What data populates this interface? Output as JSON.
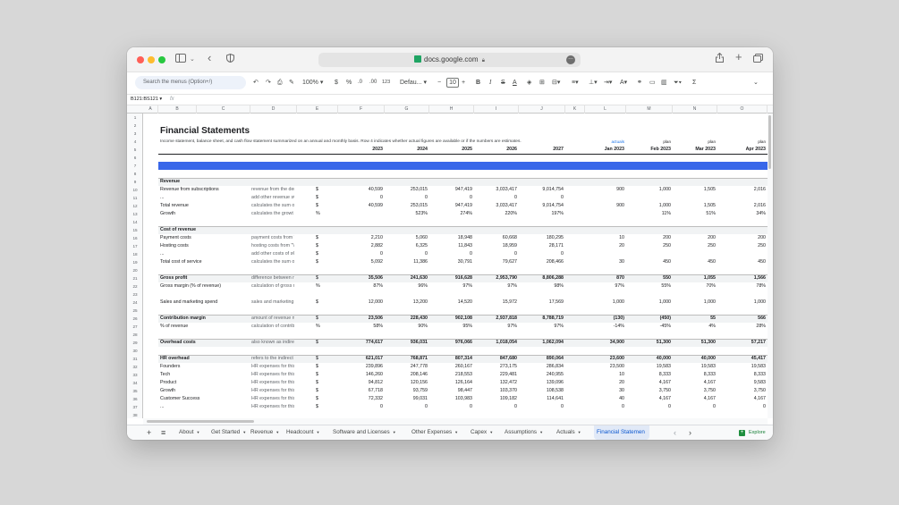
{
  "browser": {
    "url": "docs.google.com"
  },
  "toolbar": {
    "search_placeholder": "Search the menus (Option+/)",
    "zoom": "100%",
    "currency": "$",
    "percent": "%",
    "dec_less": ".0",
    "dec_more": ".00",
    "format_123": "123",
    "font": "Defau...",
    "font_size": "10",
    "bold": "B",
    "italic": "I"
  },
  "formula": {
    "name_box": "B121:BS121",
    "fx": "fx"
  },
  "columns": [
    "A",
    "B",
    "C",
    "D",
    "E",
    "F",
    "G",
    "H",
    "I",
    "J",
    "K",
    "L",
    "M",
    "N",
    "O"
  ],
  "row_numbers": [
    "1",
    "2",
    "3",
    "4",
    "5",
    "6",
    "7",
    "8",
    "9",
    "10",
    "11",
    "12",
    "13",
    "14",
    "15",
    "16",
    "17",
    "18",
    "19",
    "20",
    "21",
    "22",
    "23",
    "24",
    "25",
    "26",
    "27",
    "28",
    "29",
    "30",
    "31",
    "32",
    "33",
    "34",
    "35",
    "36",
    "37",
    "38"
  ],
  "sheet": {
    "title": "Financial Statements",
    "subtitle": "Income statement, balance sheet, and cash flow statement summarized on an annual and monthly basis. Row 4 indicates whether actual figures are available or if the numbers are estimates.",
    "status_row": [
      "actuals",
      "plan",
      "plan",
      "plan"
    ],
    "header_row": [
      "2023",
      "2024",
      "2025",
      "2026",
      "2027",
      "Jan 2023",
      "Feb 2023",
      "Mar 2023",
      "Apr 2023"
    ],
    "section": "Income Statement (P&L)",
    "rows": [
      {
        "r": 9,
        "label": "Revenue",
        "bold": true,
        "top": true
      },
      {
        "r": 10,
        "label": "Revenue from subscriptions",
        "desc": "revenue from the der",
        "unit": "$",
        "v": [
          "40,599",
          "253,015",
          "947,419",
          "3,033,417",
          "9,014,754",
          "",
          "900",
          "1,000",
          "1,505",
          "2,016"
        ]
      },
      {
        "r": 11,
        "label": "...",
        "desc": "add other revenue s€",
        "unit": "$",
        "v": [
          "0",
          "0",
          "0",
          "0",
          "0",
          "",
          "",
          "",
          "",
          ""
        ]
      },
      {
        "r": 12,
        "label": "Total revenue",
        "desc": "calculates the sum o",
        "unit": "$",
        "v": [
          "40,599",
          "253,015",
          "947,419",
          "3,033,417",
          "9,014,754",
          "",
          "900",
          "1,000",
          "1,505",
          "2,016"
        ]
      },
      {
        "r": 13,
        "label": "Growth",
        "desc": "calculates the growt",
        "unit": "%",
        "v": [
          "",
          "523%",
          "274%",
          "220%",
          "197%",
          "",
          "",
          "11%",
          "51%",
          "34%"
        ]
      },
      {
        "r": 15,
        "label": "Cost of revenue",
        "bold": true,
        "top": true
      },
      {
        "r": 16,
        "label": "Payment costs",
        "desc": "payment costs from '",
        "unit": "$",
        "v": [
          "2,210",
          "5,060",
          "18,948",
          "60,668",
          "180,295",
          "",
          "10",
          "200",
          "200",
          "200"
        ]
      },
      {
        "r": 17,
        "label": "Hosting costs",
        "desc": "hosting costs from \"\\",
        "unit": "$",
        "v": [
          "2,882",
          "6,325",
          "11,843",
          "18,959",
          "28,171",
          "",
          "20",
          "250",
          "250",
          "250"
        ]
      },
      {
        "r": 18,
        "label": "...",
        "desc": "add other costs of s€",
        "unit": "$",
        "v": [
          "0",
          "0",
          "0",
          "0",
          "0",
          "",
          "",
          "",
          "",
          ""
        ]
      },
      {
        "r": 19,
        "label": "Total cost of service",
        "desc": "calculates the sum o",
        "unit": "$",
        "v": [
          "5,092",
          "11,386",
          "30,791",
          "79,627",
          "208,466",
          "",
          "30",
          "450",
          "450",
          "450"
        ]
      },
      {
        "r": 21,
        "label": "Gross profit",
        "bold": true,
        "top": true,
        "desc": "difference between r",
        "unit": "$",
        "v": [
          "35,506",
          "241,630",
          "916,628",
          "2,953,790",
          "8,806,288",
          "",
          "870",
          "550",
          "1,055",
          "1,566"
        ]
      },
      {
        "r": 22,
        "label": "Gross margin (% of revenue)",
        "desc": "calculation of gross r",
        "unit": "%",
        "v": [
          "87%",
          "96%",
          "97%",
          "97%",
          "98%",
          "",
          "97%",
          "55%",
          "70%",
          "78%"
        ]
      },
      {
        "r": 24,
        "label": "Sales and marketing spend",
        "desc": "sales and marketing",
        "unit": "$",
        "v": [
          "12,000",
          "13,200",
          "14,520",
          "15,972",
          "17,569",
          "",
          "1,000",
          "1,000",
          "1,000",
          "1,000"
        ]
      },
      {
        "r": 26,
        "label": "Contribution margin",
        "bold": true,
        "top": true,
        "desc": "amount of revenue n",
        "unit": "$",
        "v": [
          "23,506",
          "228,430",
          "902,108",
          "2,937,818",
          "8,788,719",
          "",
          "(130)",
          "(450)",
          "55",
          "566"
        ]
      },
      {
        "r": 27,
        "label": "% of revenue",
        "desc": "calculation of contrib",
        "unit": "%",
        "v": [
          "58%",
          "90%",
          "95%",
          "97%",
          "97%",
          "",
          "-14%",
          "-45%",
          "4%",
          "28%"
        ]
      },
      {
        "r": 29,
        "label": "Overhead costs",
        "bold": true,
        "top": true,
        "desc": "also known as indire",
        "unit": "$",
        "v": [
          "774,617",
          "936,031",
          "976,066",
          "1,018,054",
          "1,062,094",
          "",
          "34,900",
          "51,300",
          "51,300",
          "57,217"
        ]
      },
      {
        "r": 31,
        "label": "HR overhead",
        "bold": true,
        "top": true,
        "desc": "refers to the indirect",
        "unit": "$",
        "v": [
          "621,017",
          "768,871",
          "807,314",
          "847,680",
          "890,064",
          "",
          "23,600",
          "40,000",
          "40,000",
          "45,417"
        ]
      },
      {
        "r": 32,
        "label": "Founders",
        "desc": "HR expenses for this",
        "unit": "$",
        "v": [
          "239,896",
          "247,778",
          "260,167",
          "273,175",
          "286,834",
          "",
          "23,500",
          "19,583",
          "19,583",
          "19,583"
        ]
      },
      {
        "r": 33,
        "label": "Tech",
        "desc": "HR expenses for this",
        "unit": "$",
        "v": [
          "146,260",
          "208,146",
          "218,553",
          "229,481",
          "240,955",
          "",
          "10",
          "8,333",
          "8,333",
          "8,333"
        ]
      },
      {
        "r": 34,
        "label": "Product",
        "desc": "HR expenses for this",
        "unit": "$",
        "v": [
          "94,812",
          "120,156",
          "126,164",
          "132,472",
          "139,096",
          "",
          "20",
          "4,167",
          "4,167",
          "9,583"
        ]
      },
      {
        "r": 35,
        "label": "Growth",
        "desc": "HR expenses for this",
        "unit": "$",
        "v": [
          "67,718",
          "93,759",
          "98,447",
          "103,370",
          "108,538",
          "",
          "30",
          "3,750",
          "3,750",
          "3,750"
        ]
      },
      {
        "r": 36,
        "label": "Customer Success",
        "desc": "HR expenses for this",
        "unit": "$",
        "v": [
          "72,332",
          "99,031",
          "103,983",
          "109,182",
          "114,641",
          "",
          "40",
          "4,167",
          "4,167",
          "4,167"
        ]
      },
      {
        "r": 37,
        "label": "...",
        "desc": "HR expenses for this",
        "unit": "$",
        "v": [
          "0",
          "0",
          "0",
          "0",
          "0",
          "",
          "0",
          "0",
          "0",
          "0"
        ]
      }
    ]
  },
  "tabs": [
    {
      "label": "About",
      "caret": true
    },
    {
      "label": "Get Started",
      "caret": true
    },
    {
      "label": "Revenue",
      "caret": true
    },
    {
      "label": "Headcount",
      "caret": true
    },
    {
      "label": "Software and Licenses",
      "caret": true
    },
    {
      "label": "Other Expenses",
      "caret": true
    },
    {
      "label": "Capex",
      "caret": true
    },
    {
      "label": "Assumptions",
      "caret": true
    },
    {
      "label": "Actuals",
      "caret": true
    },
    {
      "label": "Financial Statemen",
      "caret": false,
      "active": true
    }
  ],
  "explore": "Explore",
  "colors": {
    "band": "#3967e9",
    "active_tab": "#0b57d0",
    "actuals": "#1a73e8"
  }
}
